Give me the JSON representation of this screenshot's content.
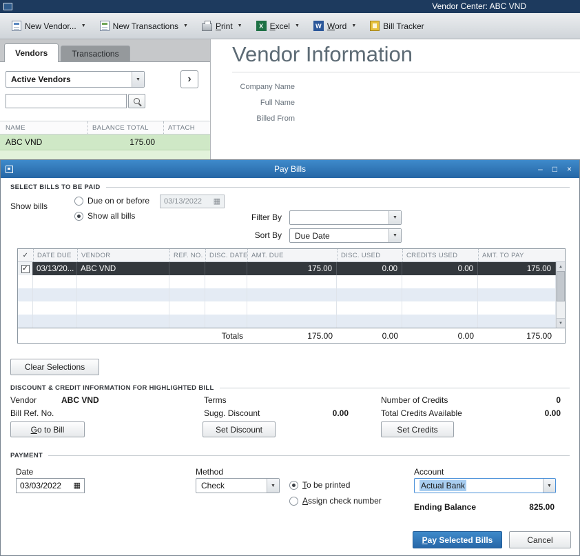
{
  "colors": {
    "titlebar_navy": "#1d3a5e",
    "dialog_title_blue_top": "#3e8acb",
    "dialog_title_blue_bottom": "#2566a5",
    "accent_blue": "#2d76b8",
    "row_green": "#cfe8c6",
    "row_green_light": "#e2f2da",
    "selected_row_dark": "#33383d",
    "alt_row_blue": "#e4ebf4",
    "selection_blue": "#a8cdf0"
  },
  "icons": {
    "dropdown_caret": "▼",
    "calendar": "▦",
    "check": "✓",
    "minimize": "–",
    "maximize": "□",
    "close": "×",
    "chevron_right": "›",
    "scroll_up": "▲",
    "scroll_down": "▼",
    "excel_glyph": "X",
    "word_glyph": "W"
  },
  "main_window": {
    "title": "Vendor Center: ABC VND",
    "toolbar": {
      "new_vendor": "New Vendor...",
      "new_transactions": "New Transactions",
      "print": "Print",
      "excel": "Excel",
      "word": "Word",
      "bill_tracker": "Bill Tracker"
    },
    "left_panel": {
      "tab_vendors": "Vendors",
      "tab_transactions": "Transactions",
      "filter_value": "Active Vendors",
      "search": {
        "value": "",
        "placeholder": ""
      },
      "columns": {
        "name": "NAME",
        "balance": "BALANCE TOTAL",
        "attach": "ATTACH"
      },
      "rows": [
        {
          "name": "ABC VND",
          "balance": "175.00"
        }
      ]
    },
    "vendor_info": {
      "heading": "Vendor Information",
      "company_name_label": "Company Name",
      "full_name_label": "Full Name",
      "billed_from_label": "Billed From"
    }
  },
  "pay_bills": {
    "title": "Pay Bills",
    "select_section": {
      "heading": "SELECT BILLS TO BE PAID",
      "show_bills_label": "Show bills",
      "radio_due": "Due on or before",
      "due_date_value": "03/13/2022",
      "radio_all": "Show all bills",
      "filter_by_label": "Filter By",
      "filter_by_value": "",
      "sort_by_label": "Sort By",
      "sort_by_value": "Due Date"
    },
    "bills_table": {
      "columns": [
        "DATE DUE",
        "VENDOR",
        "REF. NO.",
        "DISC. DATE",
        "AMT. DUE",
        "DISC. USED",
        "CREDITS USED",
        "AMT. TO PAY"
      ],
      "rows": [
        {
          "checked": true,
          "date_due": "03/13/20...",
          "vendor": "ABC VND",
          "ref_no": "",
          "disc_date": "",
          "amt_due": "175.00",
          "disc_used": "0.00",
          "credits_used": "0.00",
          "amt_to_pay": "175.00"
        }
      ],
      "totals_label": "Totals",
      "totals": {
        "amt_due": "175.00",
        "disc_used": "0.00",
        "credits_used": "0.00",
        "amt_to_pay": "175.00"
      }
    },
    "clear_selections_label": "Clear Selections",
    "discount_section": {
      "heading": "DISCOUNT & CREDIT INFORMATION FOR HIGHLIGHTED BILL",
      "vendor_label": "Vendor",
      "vendor_value": "ABC VND",
      "bill_ref_label": "Bill Ref. No.",
      "terms_label": "Terms",
      "sugg_discount_label": "Sugg. Discount",
      "sugg_discount_value": "0.00",
      "num_credits_label": "Number of Credits",
      "num_credits_value": "0",
      "total_credits_label": "Total Credits Available",
      "total_credits_value": "0.00",
      "go_to_bill_label": "Go to Bill",
      "set_discount_label": "Set Discount",
      "set_credits_label": "Set Credits"
    },
    "payment_section": {
      "heading": "PAYMENT",
      "date_label": "Date",
      "date_value": "03/03/2022",
      "method_label": "Method",
      "method_value": "Check",
      "to_be_printed_label": "To be printed",
      "assign_check_label": "Assign check number",
      "account_label": "Account",
      "account_value": "Actual Bank",
      "ending_balance_label": "Ending Balance",
      "ending_balance_value": "825.00"
    },
    "footer": {
      "pay_button": "Pay Selected Bills",
      "cancel_button": "Cancel"
    }
  }
}
